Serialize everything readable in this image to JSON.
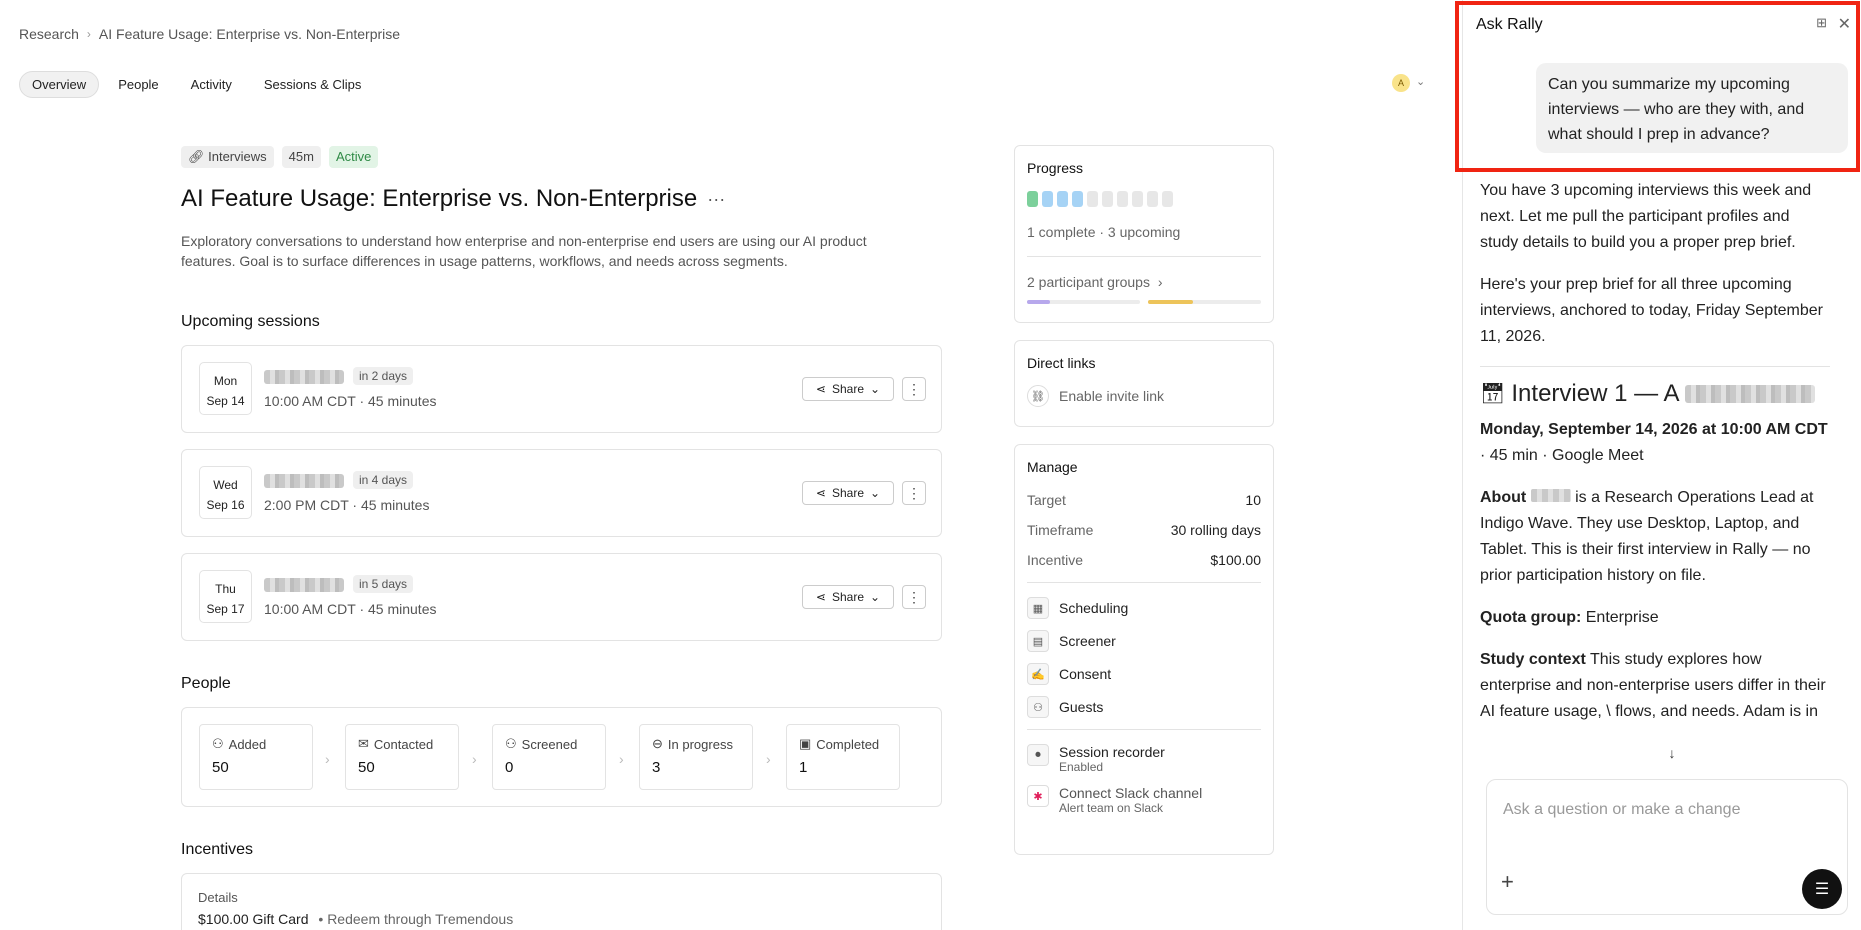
{
  "breadcrumb": {
    "root": "Research",
    "current": "AI Feature Usage: Enterprise vs. Non-Enterprise"
  },
  "tabs": [
    "Overview",
    "People",
    "Activity",
    "Sessions & Clips"
  ],
  "avatar": {
    "initial": "A"
  },
  "study": {
    "badges": {
      "type": "Interviews",
      "duration": "45m",
      "status": "Active"
    },
    "title": "AI Feature Usage: Enterprise vs. Non-Enterprise",
    "description": "Exploratory conversations to understand how enterprise and non-enterprise end users are using our AI product features. Goal is to surface differences in usage patterns, workflows, and needs across segments."
  },
  "upcoming": {
    "heading": "Upcoming sessions",
    "share_label": "Share",
    "sessions": [
      {
        "dow": "Mon",
        "date": "Sep 14",
        "relative": "in 2 days",
        "time": "10:00 AM CDT · 45 minutes"
      },
      {
        "dow": "Wed",
        "date": "Sep 16",
        "relative": "in 4 days",
        "time": "2:00 PM CDT · 45 minutes"
      },
      {
        "dow": "Thu",
        "date": "Sep 17",
        "relative": "in 5 days",
        "time": "10:00 AM CDT · 45 minutes"
      }
    ]
  },
  "people": {
    "heading": "People",
    "stages": [
      {
        "label": "Added",
        "value": "50"
      },
      {
        "label": "Contacted",
        "value": "50"
      },
      {
        "label": "Screened",
        "value": "0"
      },
      {
        "label": "In progress",
        "value": "3"
      },
      {
        "label": "Completed",
        "value": "1"
      }
    ]
  },
  "incentives": {
    "heading": "Incentives",
    "details_label": "Details",
    "amount": "$100.00 Gift Card",
    "note": "• Redeem through Tremendous"
  },
  "progress": {
    "heading": "Progress",
    "summary": "1 complete · 3 upcoming",
    "groups_link": "2 participant groups",
    "group1_fill": 0.2,
    "group2_fill": 0.4
  },
  "direct_links": {
    "heading": "Direct links",
    "invite": "Enable invite link"
  },
  "manage": {
    "heading": "Manage",
    "kv": [
      {
        "k": "Target",
        "v": "10"
      },
      {
        "k": "Timeframe",
        "v": "30 rolling days"
      },
      {
        "k": "Incentive",
        "v": "$100.00"
      }
    ],
    "items": [
      "Scheduling",
      "Screener",
      "Consent",
      "Guests"
    ],
    "recorder": {
      "label": "Session recorder",
      "status": "Enabled"
    },
    "slack": {
      "label": "Connect Slack channel",
      "sub": "Alert team on Slack"
    }
  },
  "chat": {
    "title": "Ask Rally",
    "user_message": "Can you summarize my upcoming interviews — who are they with, and what should I prep in advance?",
    "reply1": "You have 3 upcoming interviews this week and next. Let me pull the participant profiles and study details to build you a proper prep brief.",
    "reply2": "Here's your prep brief for all three upcoming interviews, anchored to today, Friday September 11, 2026.",
    "interview_heading": "Interview 1 — A",
    "when_bold": "Monday, September 14, 2026 at 10:00 AM CDT",
    "when_rest": " · 45 min · Google Meet",
    "about_label": "About",
    "about_text": " is a Research Operations Lead at Indigo Wave. They use Desktop, Laptop, and Tablet. This is their first interview in Rally — no prior participation history on file.",
    "quota_label": "Quota group:",
    "quota_value": " Enterprise",
    "context_label": "Study context",
    "context_text": " This study explores how enterprise and non-enterprise users differ in their AI feature usage, \\ flows, and needs. Adam is in the Enterprise segment, making",
    "input_placeholder": "Ask a question or make a change"
  },
  "colors": {
    "highlight": "#f02412",
    "active_badge": "#2f8a46"
  }
}
